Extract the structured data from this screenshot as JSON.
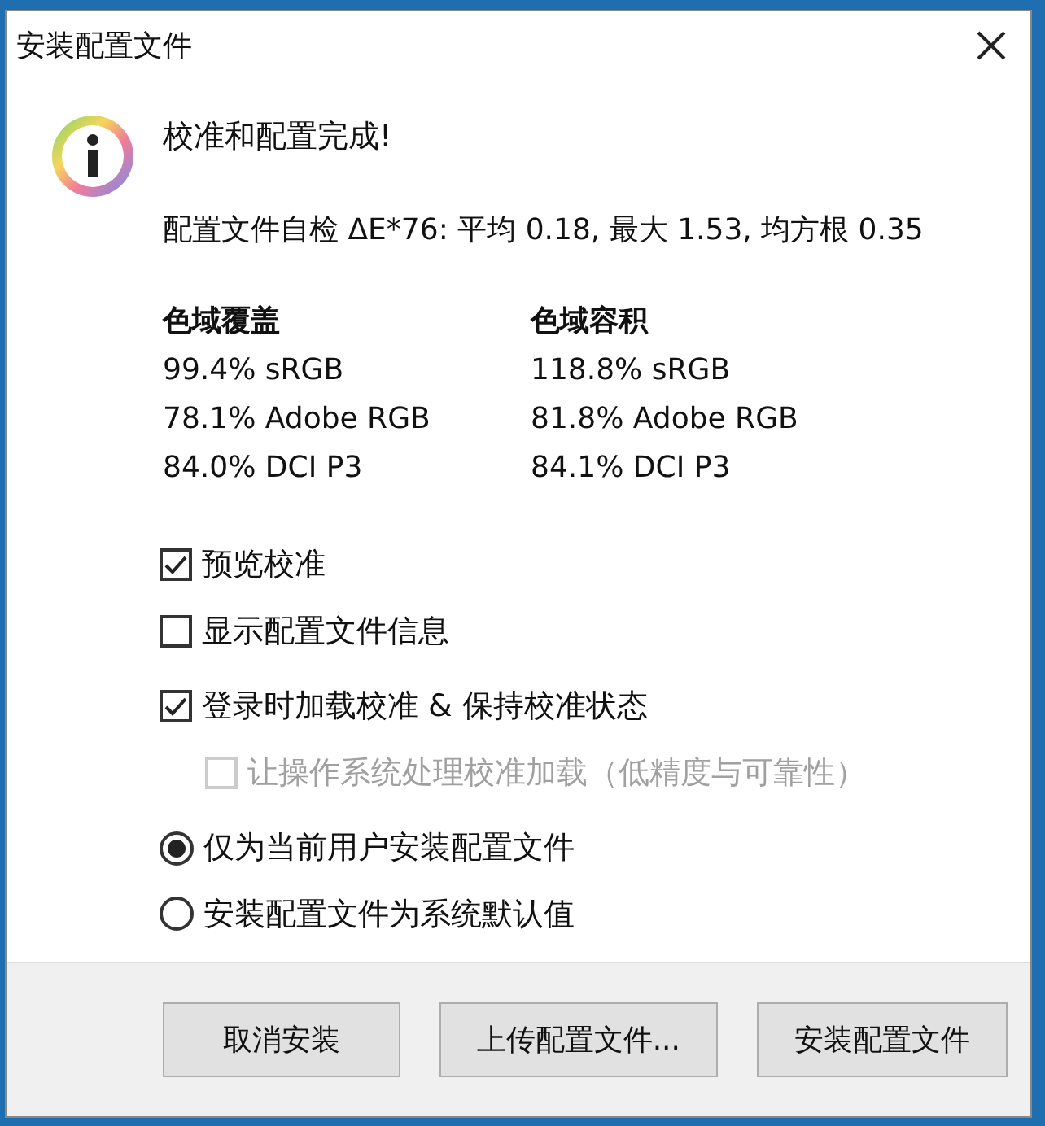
{
  "window": {
    "title": "安装配置文件"
  },
  "message": "校准和配置完成!",
  "self_check": "配置文件自检 ΔE*76: 平均 0.18, 最大 1.53, 均方根 0.35",
  "gamut_columns": [
    {
      "heading": "色域覆盖",
      "rows": [
        "99.4% sRGB",
        "78.1% Adobe RGB",
        "84.0% DCI P3"
      ]
    },
    {
      "heading": "色域容积",
      "rows": [
        "118.8% sRGB",
        "81.8% Adobe RGB",
        "84.1% DCI P3"
      ]
    }
  ],
  "option_groups": [
    [
      {
        "kind": "checkbox",
        "label": "预览校准",
        "checked": true,
        "disabled": false
      },
      {
        "kind": "checkbox",
        "label": "显示配置文件信息",
        "checked": false,
        "disabled": false
      }
    ],
    [
      {
        "kind": "checkbox",
        "label": "登录时加载校准 & 保持校准状态",
        "checked": true,
        "disabled": false,
        "children": [
          {
            "kind": "checkbox",
            "label": "让操作系统处理校准加载（低精度与可靠性）",
            "checked": false,
            "disabled": true
          }
        ]
      }
    ],
    [
      {
        "kind": "radio",
        "label": "仅为当前用户安装配置文件",
        "selected": true,
        "disabled": false
      },
      {
        "kind": "radio",
        "label": "安装配置文件为系统默认值",
        "selected": false,
        "disabled": false
      }
    ]
  ],
  "buttons": [
    "取消安装",
    "上传配置文件...",
    "安装配置文件"
  ]
}
